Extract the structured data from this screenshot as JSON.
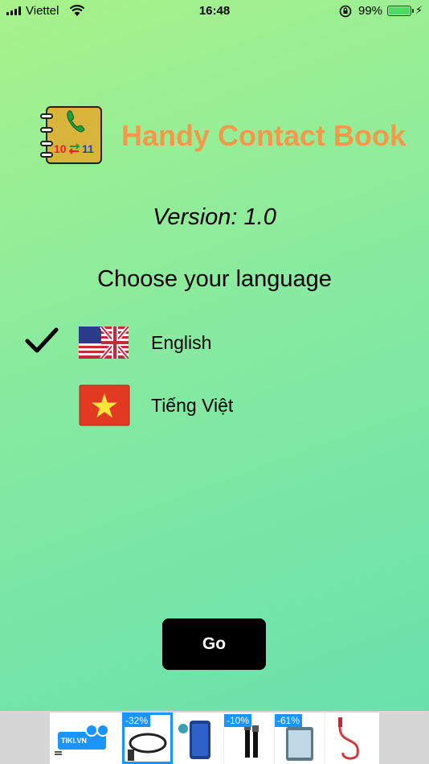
{
  "status_bar": {
    "carrier": "Viettel",
    "time": "16:48",
    "battery_percent": "99%",
    "battery_level": 0.99
  },
  "header": {
    "app_title": "Handy Contact Book",
    "icon_left_number": "10",
    "icon_right_number": "11"
  },
  "version": "Version: 1.0",
  "prompt": "Choose your language",
  "languages": [
    {
      "label": "English",
      "flag": "uk-flag-icon",
      "selected": true
    },
    {
      "label": "Tiếng Việt",
      "flag": "vietnam-flag-icon",
      "selected": false
    }
  ],
  "go_button": {
    "label": "Go"
  },
  "ad": {
    "brand": "TIKI.VN",
    "discounts": [
      "-32%",
      "-10%",
      "-61%"
    ]
  },
  "colors": {
    "title": "#f29a4a",
    "background_top": "#a8f28a",
    "background_bottom": "#66dfae",
    "button": "#000000"
  }
}
